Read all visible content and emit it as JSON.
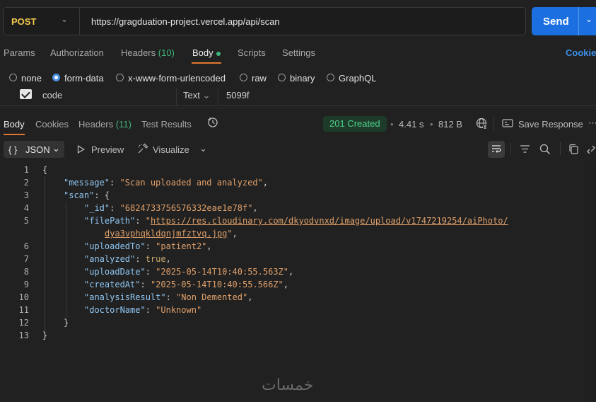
{
  "request": {
    "method": "POST",
    "url": "https://gragduation-project.vercel.app/api/scan",
    "send_label": "Send"
  },
  "request_tabs": {
    "params": "Params",
    "authorization": "Authorization",
    "headers": "Headers",
    "headers_count": "(10)",
    "body": "Body",
    "scripts": "Scripts",
    "settings": "Settings",
    "cookies": "Cookies"
  },
  "body_types": [
    "none",
    "form-data",
    "x-www-form-urlencoded",
    "raw",
    "binary",
    "GraphQL"
  ],
  "selected_body_type": "form-data",
  "form_row": {
    "key": "code",
    "type": "Text",
    "value": "5099f"
  },
  "response_tabs": {
    "body": "Body",
    "cookies": "Cookies",
    "headers": "Headers",
    "headers_count": "(11)",
    "test_results": "Test Results"
  },
  "response_meta": {
    "status": "201 Created",
    "time": "4.41 s",
    "size": "812 B",
    "save_response": "Save Response"
  },
  "viewer": {
    "format": "JSON",
    "preview": "Preview",
    "visualize": "Visualize"
  },
  "code_lines": [
    {
      "n": "1"
    },
    {
      "n": "2"
    },
    {
      "n": "3"
    },
    {
      "n": "4"
    },
    {
      "n": "5"
    },
    {
      "n": ""
    },
    {
      "n": "6"
    },
    {
      "n": "7"
    },
    {
      "n": "8"
    },
    {
      "n": "9"
    },
    {
      "n": "10"
    },
    {
      "n": "11"
    },
    {
      "n": "12"
    },
    {
      "n": "13"
    }
  ],
  "json": {
    "message_key": "\"message\"",
    "message_val": "\"Scan uploaded and analyzed\"",
    "scan_key": "\"scan\"",
    "id_key": "\"_id\"",
    "id_val": "\"6824733756576332eae1e78f\"",
    "filepath_key": "\"filePath\"",
    "filepath_val_1": "https://res.cloudinary.com/dkyodvnxd/image/upload/v1747219254/aiPhoto/",
    "filepath_val_2": "dya3vphqkldqnjmfztvq.jpg",
    "uploadedto_key": "\"uploadedTo\"",
    "uploadedto_val": "\"patient2\"",
    "analyzed_key": "\"analyzed\"",
    "analyzed_val": "true",
    "uploaddate_key": "\"uploadDate\"",
    "uploaddate_val": "\"2025-05-14T10:40:55.563Z\"",
    "createdat_key": "\"createdAt\"",
    "createdat_val": "\"2025-05-14T10:40:55.566Z\"",
    "analysisresult_key": "\"analysisResult\"",
    "analysisresult_val": "\"Non Demented\"",
    "doctorname_key": "\"doctorName\"",
    "doctorname_val": "\"Unknown\""
  },
  "watermark": "خمسات",
  "colors": {
    "background": "#212121",
    "send": "#1b6fe0",
    "method": "#f2c94c",
    "accent_underline": "#e0762f",
    "status_text": "#4fd18b",
    "json_key": "#8fc6f2",
    "json_string": "#e0a06a"
  }
}
